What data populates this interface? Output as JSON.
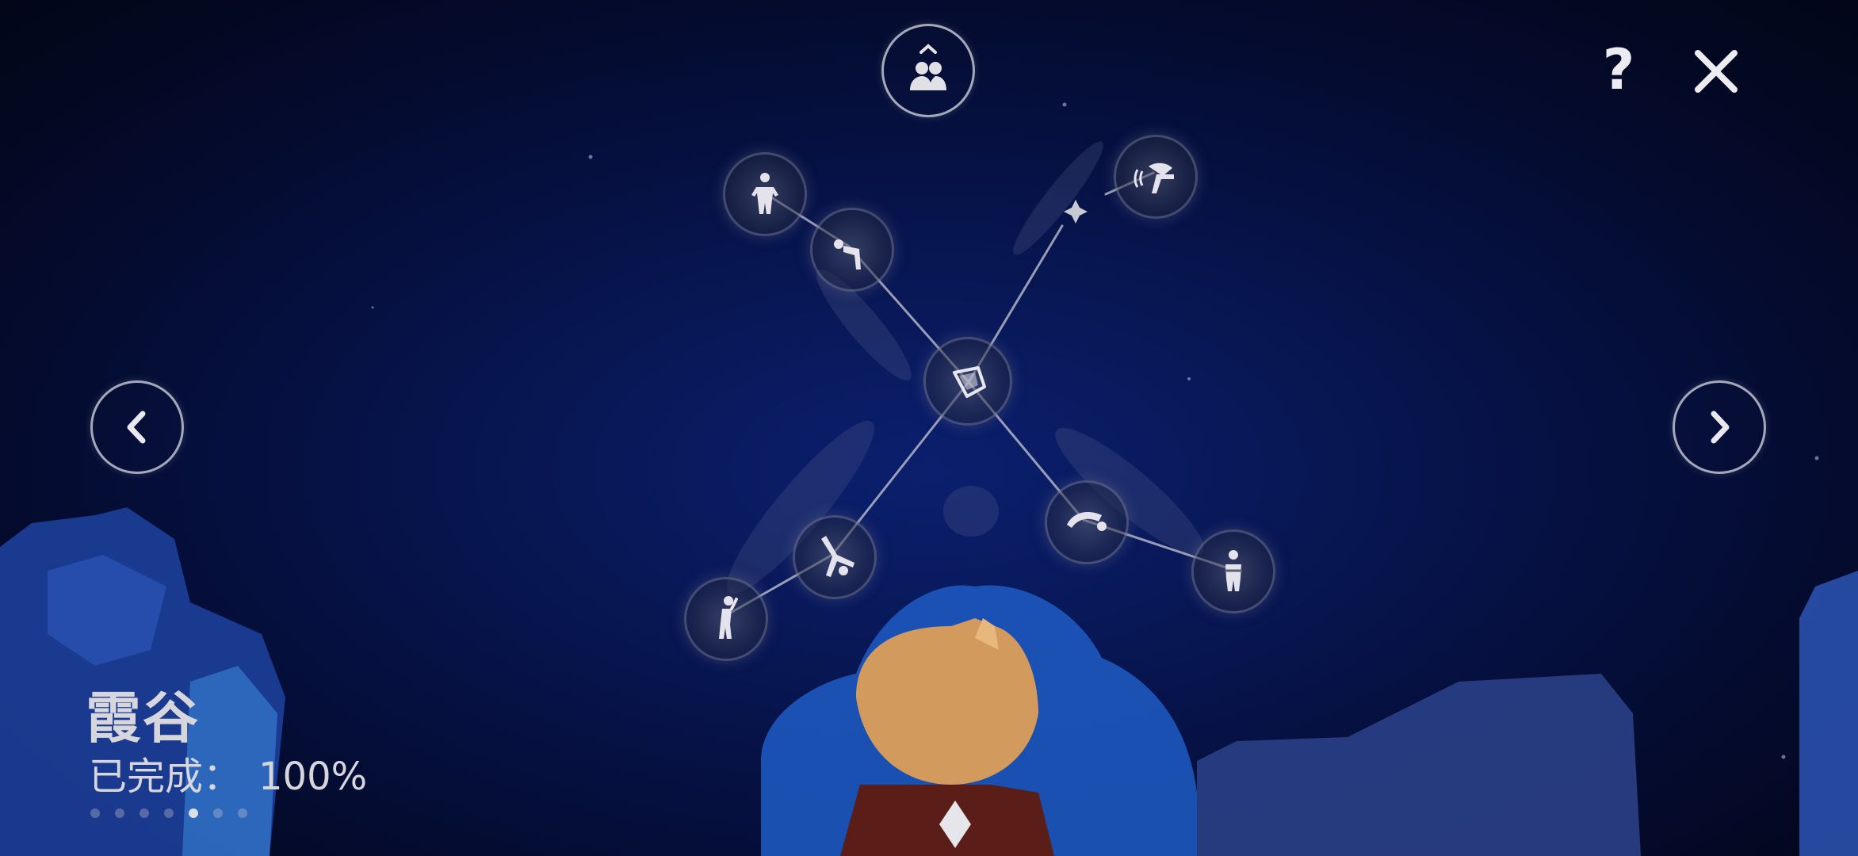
{
  "header": {
    "friends_icon": "friends-expand-icon",
    "help_label": "?",
    "close_label": "✕"
  },
  "navigation": {
    "prev_icon": "chevron-left-icon",
    "next_icon": "chevron-right-icon"
  },
  "constellation": {
    "center_node": "shield-emote-icon",
    "nodes": [
      {
        "id": "stand",
        "icon": "standing-person-icon"
      },
      {
        "id": "bow",
        "icon": "bowing-person-icon"
      },
      {
        "id": "wave",
        "icon": "wave-gesture-icon"
      },
      {
        "id": "dive",
        "icon": "diving-person-icon"
      },
      {
        "id": "arms-crossed",
        "icon": "arms-crossed-person-icon"
      },
      {
        "id": "cartwheel",
        "icon": "cartwheel-person-icon"
      },
      {
        "id": "stretch",
        "icon": "stretching-person-icon"
      }
    ]
  },
  "area": {
    "title": "霞谷",
    "progress_label": "已完成：",
    "progress_value": "100%",
    "page_count": 7,
    "active_page": 5
  },
  "colors": {
    "background": "#040b2e",
    "accent": "#d6d6dc"
  }
}
